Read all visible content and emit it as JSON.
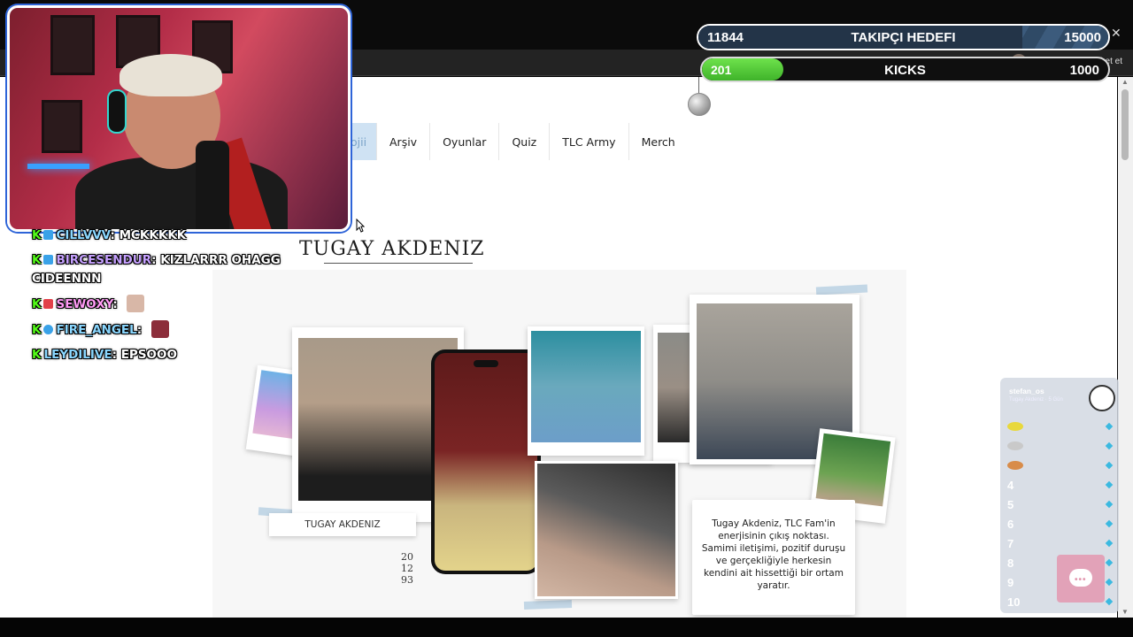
{
  "nav": {
    "active_partial": "ojii",
    "items": [
      "Arşiv",
      "Oyunlar",
      "Quiz",
      "TLC Army",
      "Merch"
    ]
  },
  "hero": {
    "title": "TUGAY AKDENIZ",
    "caption": "TUGAY AKDENIZ",
    "year": [
      "20",
      "12",
      "93"
    ],
    "description": "Tugay Akdeniz, TLC Fam'in enerjisinin çıkış noktası. Samimi iletişimi, pozitif duruşu ve gerçekliğiyle herkesin kendini ait hissettiği bir ortam yaratır."
  },
  "browser": {
    "chat_label": "Sohbet et"
  },
  "stream_goal": {
    "current": "11844",
    "label": "TAKIPÇI HEDEFI",
    "target": "15000",
    "progress": 0.79
  },
  "kicks_goal": {
    "current": "201",
    "label": "KICKS",
    "target": "1000",
    "progress": 0.2
  },
  "chat": [
    {
      "user": "CILLVVV",
      "msg": "MCKKKKK"
    },
    {
      "user": "BIRCESENDUR",
      "msg": "KIZLARRR OHAGG CIDEENNN"
    },
    {
      "user": "SEWOXY",
      "msg": ""
    },
    {
      "user": "FIRE_ANGEL",
      "msg": ""
    },
    {
      "user": "LEYDILIVE",
      "msg": "EPSOOO"
    }
  ],
  "leaderboard": {
    "title": "stefan_os",
    "subtitle": "Tugay Akdeniz · 5 Gün",
    "ranks": [
      "4",
      "5",
      "6",
      "7",
      "8",
      "9",
      "10"
    ]
  },
  "colors": {
    "accent": "#cfe2f3",
    "kick_green": "#53fc18",
    "goal_bg": "#1c2733"
  },
  "icons": [
    "chat-bubble-icon",
    "disco-ball-icon",
    "cursor-icon",
    "close-icon",
    "kick-logo-icon"
  ]
}
